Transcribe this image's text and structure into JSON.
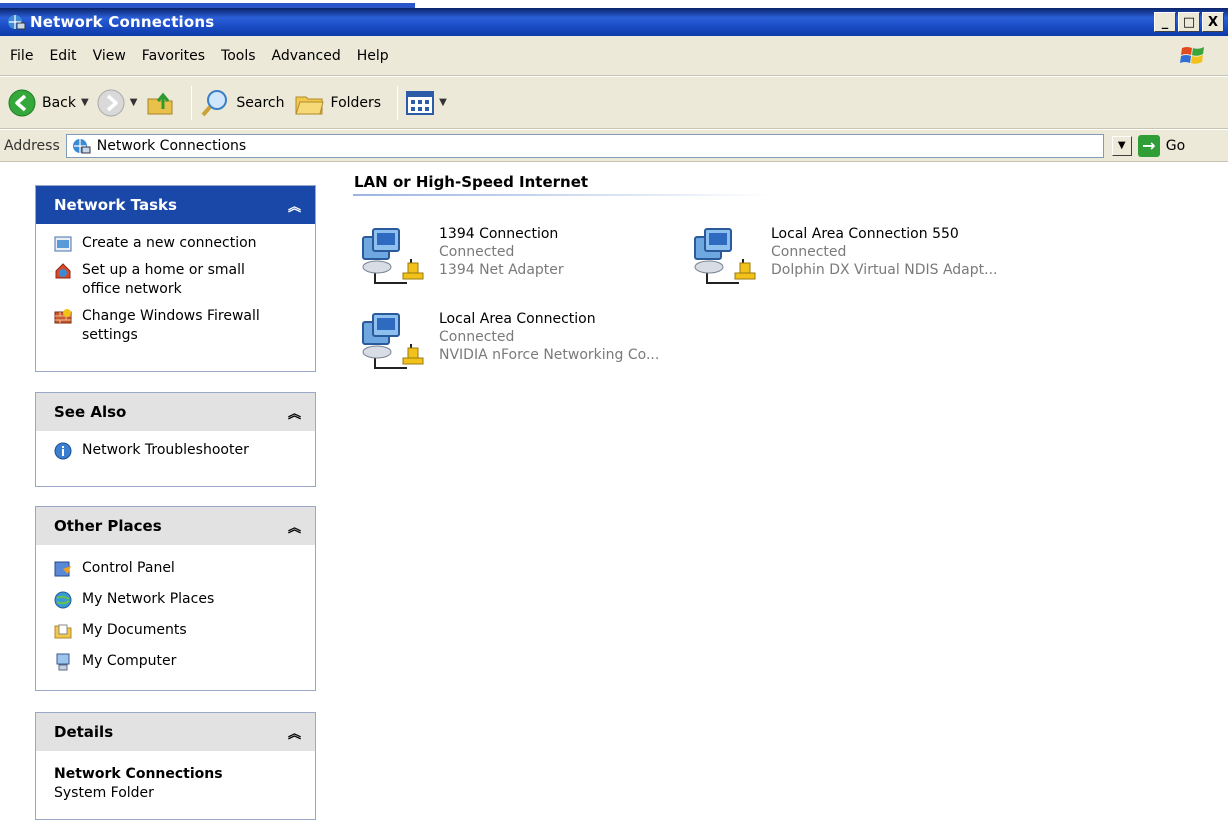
{
  "window": {
    "title": "Network Connections"
  },
  "titlebar_buttons": [
    "_",
    "□",
    "X"
  ],
  "menu": [
    "File",
    "Edit",
    "View",
    "Favorites",
    "Tools",
    "Advanced",
    "Help"
  ],
  "toolbar": {
    "back_label": "Back",
    "search_label": "Search",
    "folders_label": "Folders"
  },
  "address": {
    "label": "Address",
    "value": "Network Connections",
    "go_label": "Go"
  },
  "panels": {
    "network_tasks": {
      "title": "Network Tasks",
      "items": [
        "Create a new connection",
        "Set up a home or small office network",
        "Change Windows Firewall settings"
      ]
    },
    "see_also": {
      "title": "See Also",
      "items": [
        "Network Troubleshooter"
      ]
    },
    "other_places": {
      "title": "Other Places",
      "items": [
        "Control Panel",
        "My Network Places",
        "My Documents",
        "My Computer"
      ]
    },
    "details": {
      "title": "Details",
      "name": "Network Connections",
      "type": "System Folder"
    }
  },
  "group": {
    "title": "LAN or High-Speed Internet",
    "connections": [
      {
        "name": "1394 Connection",
        "status": "Connected",
        "device": "1394 Net Adapter"
      },
      {
        "name": "Local Area Connection 550",
        "status": "Connected",
        "device": "Dolphin DX Virtual NDIS Adapt..."
      },
      {
        "name": "Local Area Connection",
        "status": "Connected",
        "device": "NVIDIA nForce Networking Co..."
      }
    ]
  },
  "colors": {
    "titlebar": "#1d4fc9",
    "chrome": "#ece9d8",
    "panel_header_primary": "#1a48a8",
    "panel_header": "#e2e2e2",
    "subtext": "#7a7a7a"
  }
}
